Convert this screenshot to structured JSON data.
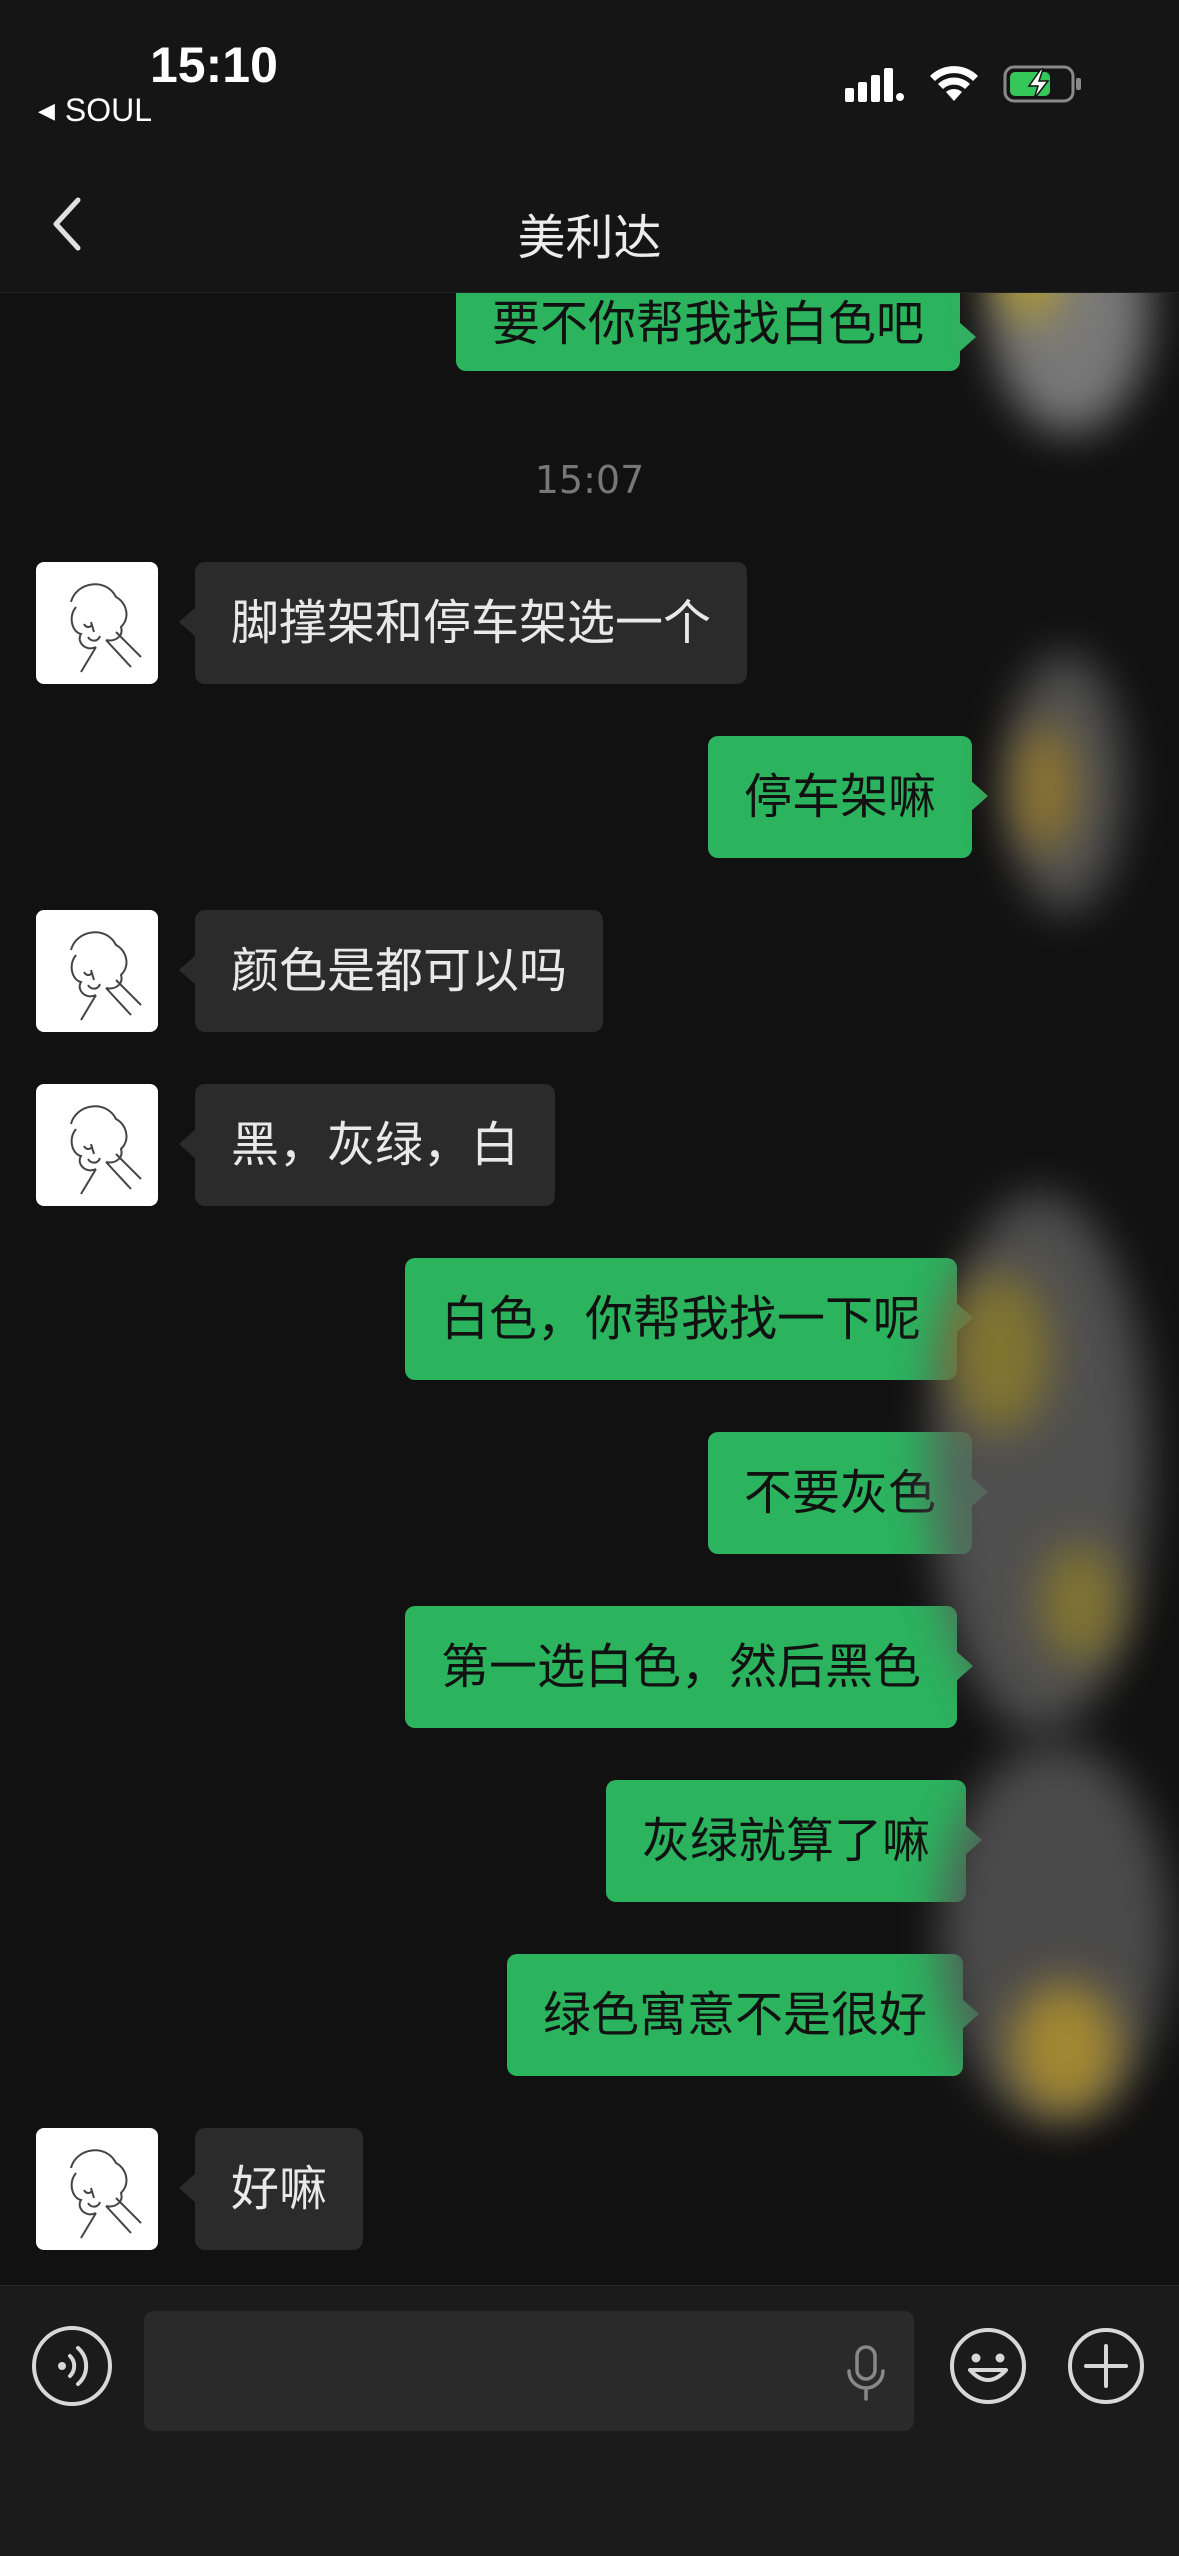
{
  "status_bar": {
    "time": "15:10",
    "back_app_label": "SOUL",
    "back_arrow_glyph": "◀",
    "icons": [
      "cellular-signal-icon",
      "wifi-icon",
      "battery-charging-icon"
    ]
  },
  "nav": {
    "title": "美利达",
    "back_icon": "chevron-left-icon"
  },
  "chat": {
    "timestamp": "15:07",
    "messages": [
      {
        "direction": "out",
        "text": "要不你帮我找白色吧"
      },
      {
        "direction": "in",
        "text": "脚撑架和停车架选一个"
      },
      {
        "direction": "out",
        "text": "停车架嘛"
      },
      {
        "direction": "in",
        "text": "颜色是都可以吗"
      },
      {
        "direction": "in",
        "text": "黑，灰绿，白"
      },
      {
        "direction": "out",
        "text": "白色，你帮我找一下呢"
      },
      {
        "direction": "out",
        "text": "不要灰色"
      },
      {
        "direction": "out",
        "text": "第一选白色，然后黑色"
      },
      {
        "direction": "out",
        "text": "灰绿就算了嘛"
      },
      {
        "direction": "out",
        "text": "绿色寓意不是很好"
      },
      {
        "direction": "in",
        "text": "好嘛"
      }
    ]
  },
  "input_bar": {
    "voice_icon": "voice-mode-icon",
    "mic_icon": "microphone-icon",
    "emoji_icon": "emoji-icon",
    "plus_icon": "plus-icon"
  },
  "colors": {
    "background": "#111111",
    "outgoing_bubble": "#2bb35e",
    "incoming_bubble": "#2b2b2b",
    "bar_background": "#1b1b1b"
  }
}
